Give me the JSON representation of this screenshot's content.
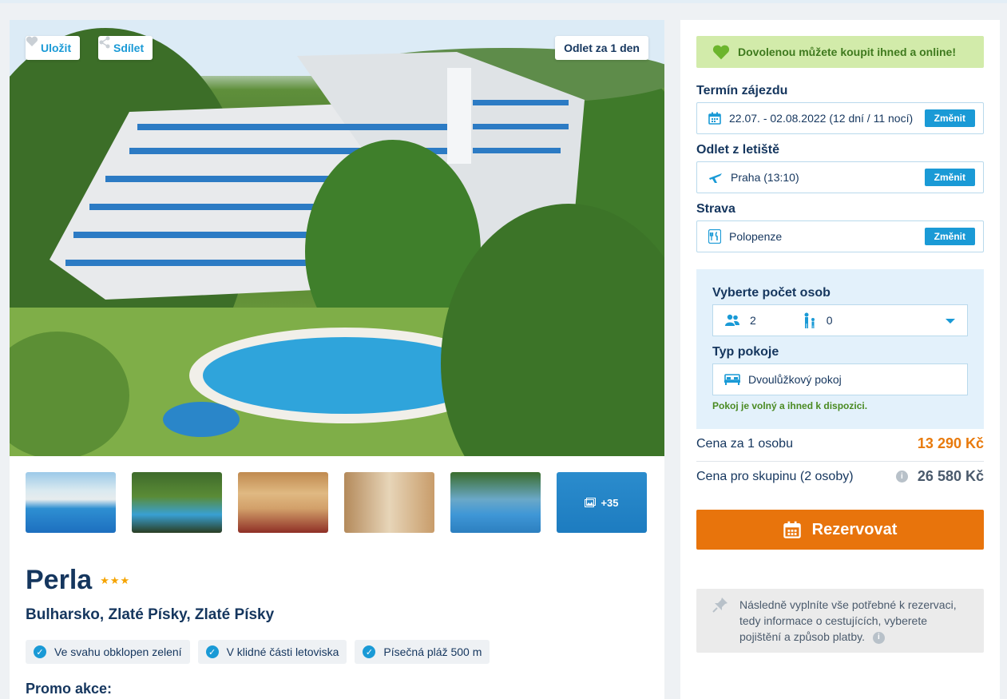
{
  "hero": {
    "save_label": "Uložit",
    "share_label": "Sdílet",
    "departure_label": "Odlet za 1 den"
  },
  "gallery": {
    "more_count": "+35"
  },
  "hotel": {
    "name": "Perla",
    "stars": "★★★",
    "location": "Bulharsko, Zlaté Písky, Zlaté Písky",
    "tags": [
      "Ve svahu obklopen zelení",
      "V klidné části letoviska",
      "Písečná pláž 500 m"
    ],
    "promo_label": "Promo akce:"
  },
  "booking": {
    "banner": "Dovolenou můžete koupit ihned a online!",
    "term_label": "Termín zájezdu",
    "term_value": "22.07. - 02.08.2022 (12 dní / 11 nocí)",
    "flight_label": "Odlet z letiště",
    "flight_value": "Praha (13:10)",
    "board_label": "Strava",
    "board_value": "Polopenze",
    "change_label": "Změnit",
    "persons_label": "Vyberte počet osob",
    "adults": "2",
    "children": "0",
    "room_label": "Typ pokoje",
    "room_value": "Dvoulůžkový pokoj",
    "availability": "Pokoj je volný a ihned k dispozici.",
    "price_person_label": "Cena za 1 osobu",
    "price_person_value": "13 290 Kč",
    "price_group_label": "Cena pro skupinu (2 osoby)",
    "price_group_value": "26 580 Kč",
    "reserve_label": "Rezervovat",
    "note_text": "Následně vyplníte vše potřebné k rezervaci, tedy informace o cestujících, vyberete pojištění a způsob platby."
  },
  "colors": {
    "accent": "#1a9ad6",
    "cta": "#e8740c",
    "navy": "#15365e",
    "success_bg": "#d2ebaa"
  }
}
